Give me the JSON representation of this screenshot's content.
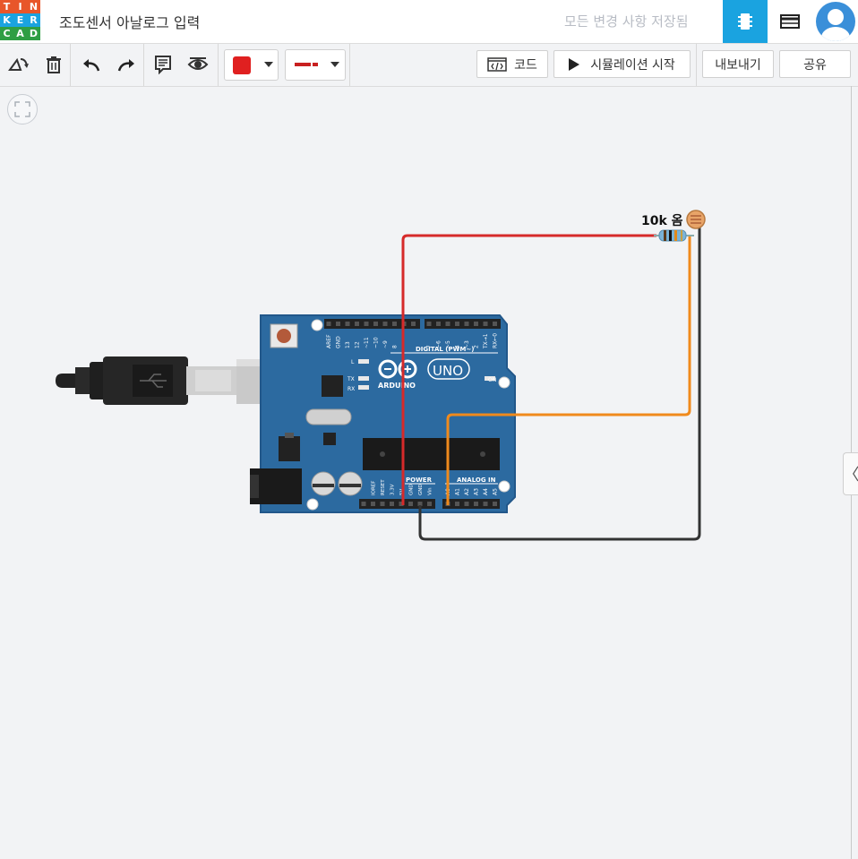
{
  "header": {
    "logo_letters": [
      "T",
      "I",
      "N",
      "K",
      "E",
      "R",
      "C",
      "A",
      "D"
    ],
    "logo_colors": [
      "#e8562a",
      "#e8562a",
      "#e8562a",
      "#1aa3e0",
      "#1aa3e0",
      "#1aa3e0",
      "#2f9e44",
      "#2f9e44",
      "#2f9e44"
    ],
    "title": "조도센서 아날로그 입력",
    "save_status": "모든 변경 사항 저장됨",
    "circuit_view_icon": "chip-icon",
    "components_list_icon": "table-icon",
    "accent_color": "#1aa3e0"
  },
  "toolbar": {
    "rotate_icon": "rotate-icon",
    "delete_icon": "trash-icon",
    "undo_icon": "undo-icon",
    "redo_icon": "redo-icon",
    "notes_icon": "notes-icon",
    "visibility_icon": "eye-icon",
    "wire_color": "#e02020",
    "code_label": "코드",
    "simulate_label": "시뮬레이션 시작",
    "export_label": "내보내기",
    "share_label": "공유"
  },
  "canvas": {
    "fit_icon": "fit-view-icon",
    "collapse_icon": "chevron-left-icon",
    "resistor_label": "10k 옴",
    "board": {
      "logo_text": "ARDUINO",
      "model": "UNO",
      "digital_label": "DIGITAL (PWM~)",
      "power_label": "POWER",
      "analog_label": "ANALOG IN",
      "on_label": "ON",
      "l_label": "L",
      "tx_label": "TX",
      "rx_label": "RX",
      "top_pins": [
        "AREF",
        "GND",
        "13",
        "12",
        "~11",
        "~10",
        "~9",
        "8",
        "7",
        "~6",
        "~5",
        "4",
        "~3",
        "2",
        "TX→1",
        "RX←0"
      ],
      "power_pins": [
        "IOREF",
        "RESET",
        "3.3V",
        "5V",
        "GND",
        "GND",
        "Vin"
      ],
      "analog_pins": [
        "A0",
        "A1",
        "A2",
        "A3",
        "A4",
        "A5"
      ]
    },
    "wire_colors": {
      "red": "#d62a2a",
      "orange": "#f08a1c",
      "black": "#333333"
    }
  }
}
